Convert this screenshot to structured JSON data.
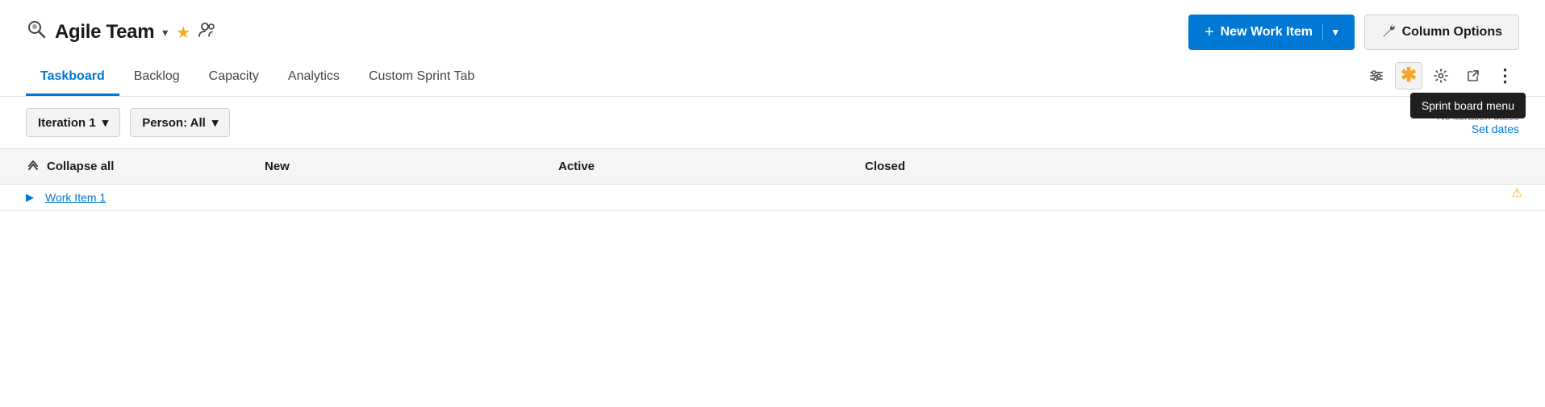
{
  "header": {
    "team_icon": "🔍",
    "team_name": "Agile Team",
    "chevron_label": "▾",
    "star_icon": "★",
    "members_icon": "👥",
    "new_work_item_label": "New Work Item",
    "new_work_item_plus": "+",
    "new_work_item_chevron": "▾",
    "column_options_label": "Column Options",
    "wrench_icon": "🔧"
  },
  "tabs": {
    "items": [
      {
        "id": "taskboard",
        "label": "Taskboard",
        "active": true
      },
      {
        "id": "backlog",
        "label": "Backlog",
        "active": false
      },
      {
        "id": "capacity",
        "label": "Capacity",
        "active": false
      },
      {
        "id": "analytics",
        "label": "Analytics",
        "active": false
      },
      {
        "id": "custom-sprint-tab",
        "label": "Custom Sprint Tab",
        "active": false
      }
    ]
  },
  "tab_actions": {
    "filter_icon": "⚙",
    "asterisk": "*",
    "gear_icon": "⚙",
    "expand_icon": "↗",
    "more_icon": "⋮",
    "tooltip_text": "Sprint board menu"
  },
  "filters": {
    "iteration_label": "Iteration 1",
    "iteration_chevron": "▾",
    "person_label": "Person: All",
    "person_chevron": "▾",
    "no_iteration_notice": "No iteration dates",
    "set_dates_label": "Set dates"
  },
  "table_header": {
    "collapse_icon": "⋀",
    "collapse_all_label": "Collapse all",
    "col_new": "New",
    "col_active": "Active",
    "col_closed": "Closed"
  },
  "partial_row": {
    "arrow": "▶",
    "text": "Work Item 1"
  },
  "colors": {
    "accent_blue": "#0078d4",
    "accent_orange": "#f5a623",
    "tab_active_border": "#0078d4",
    "background": "#ffffff",
    "surface": "#f3f3f3",
    "border": "#d1d1d1"
  }
}
